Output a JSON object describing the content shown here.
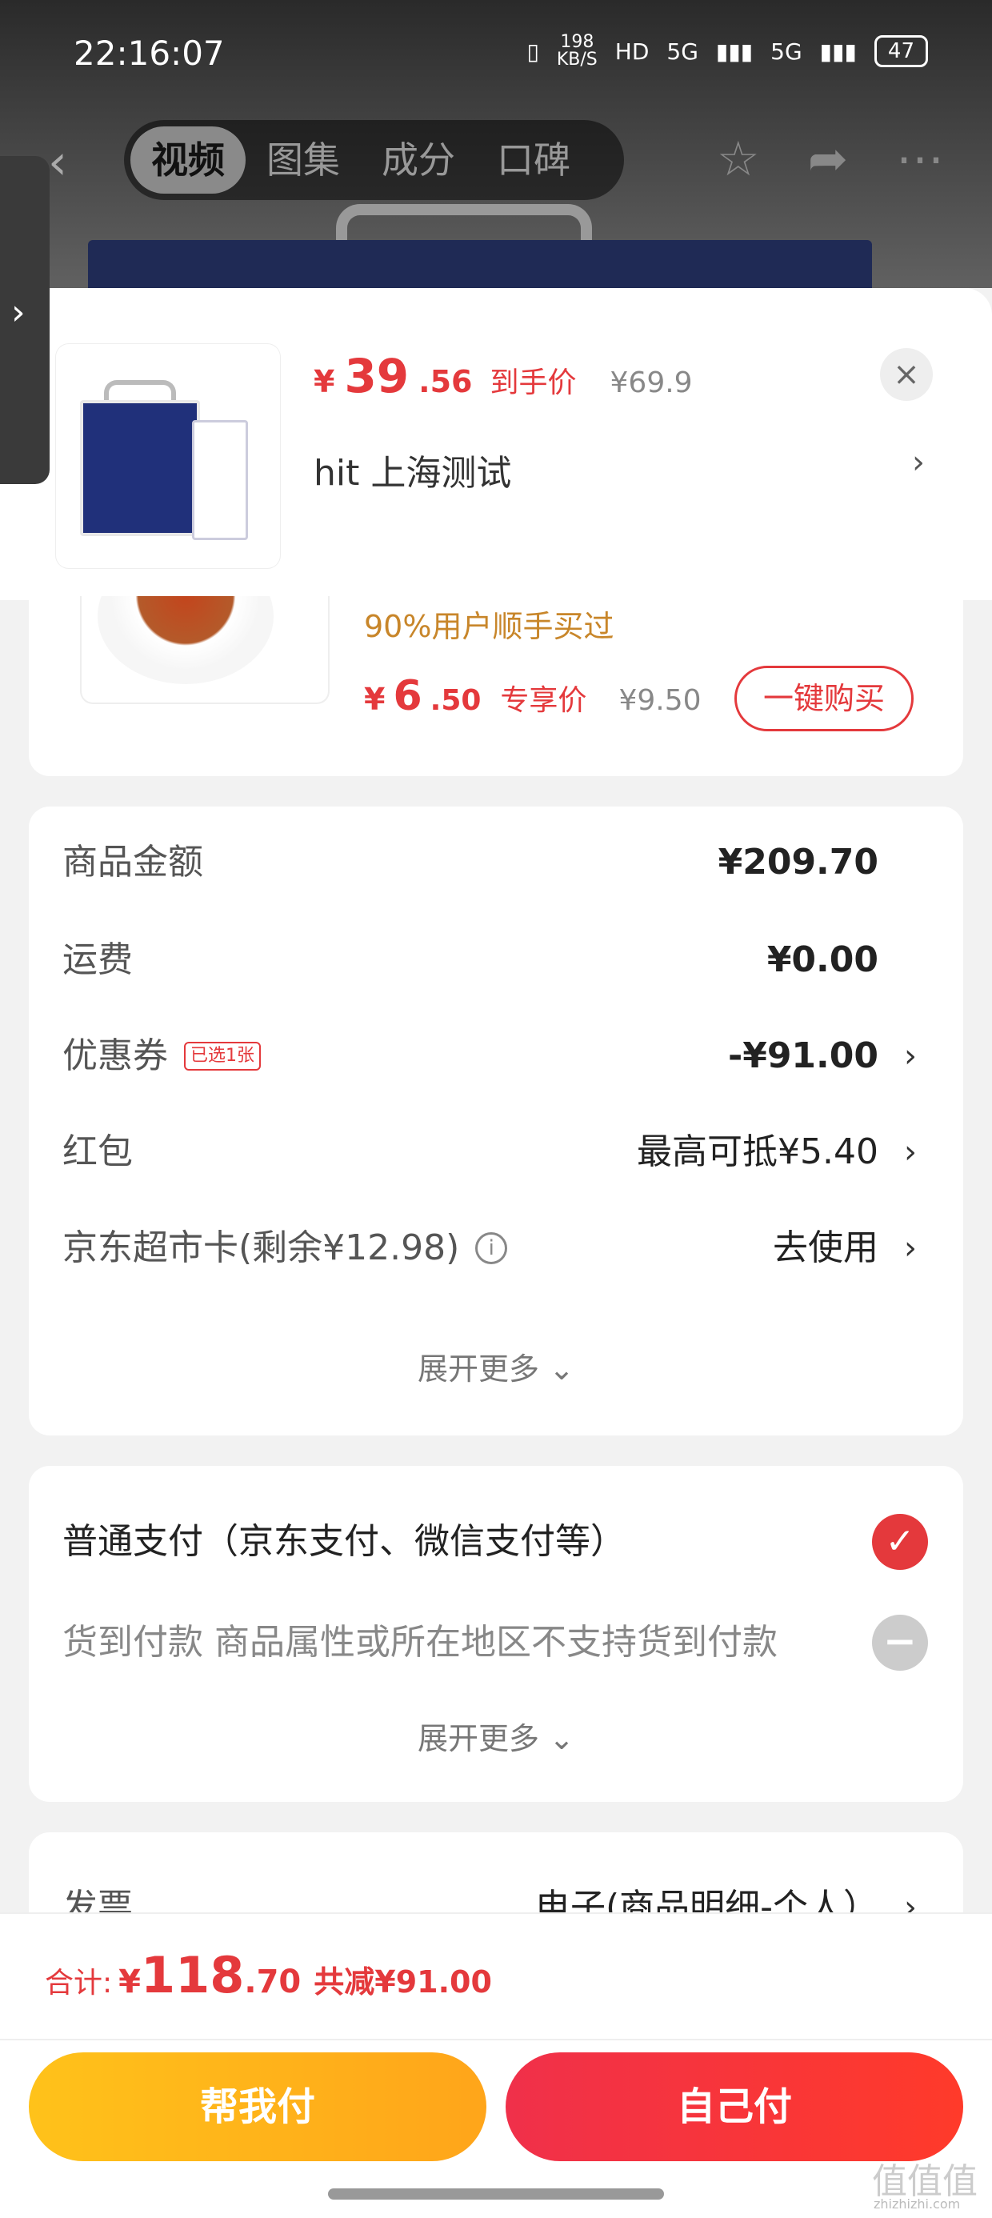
{
  "status_bar": {
    "time": "22:16:07",
    "net_speed": "198",
    "net_unit": "KB/S",
    "hd": "HD",
    "sig1": "5G",
    "sig2": "5G",
    "battery": "47"
  },
  "nav": {
    "tabs": [
      "视频",
      "图集",
      "成分",
      "口碑"
    ]
  },
  "product": {
    "price_symbol": "¥",
    "price_int": "39",
    "price_dec": ".56",
    "price_label": "到手价",
    "orig_price": "¥69.9",
    "close": "×",
    "address": "hit  上海测试",
    "address_arrow": "›"
  },
  "recommend": {
    "buyers": "90%用户顺手买过",
    "price_symbol": "¥",
    "price_int": "6",
    "price_dec": ".50",
    "price_label": "专享价",
    "orig_price": "¥9.50",
    "buy_button": "一键购买"
  },
  "costs": {
    "goods_label": "商品金额",
    "goods_value": "¥209.70",
    "shipping_label": "运费",
    "shipping_value": "¥0.00",
    "coupon_label": "优惠券",
    "coupon_tag": "已选1张",
    "coupon_value": "-¥91.00",
    "redpack_label": "红包",
    "redpack_value": "最高可抵¥5.40",
    "card_label": "京东超市卡(剩余¥12.98)",
    "card_info": "i",
    "card_value": "去使用",
    "arrow": "›",
    "expand": "展开更多 ⌄"
  },
  "payment": {
    "normal_label": "普通支付（京东支付、微信支付等）",
    "cod_label": "货到付款 商品属性或所在地区不支持货到付款",
    "check": "✓",
    "disabled": "−",
    "expand": "展开更多 ⌄"
  },
  "invoice": {
    "label": "发票",
    "value": "电子(商品明细-个人）",
    "arrow": "›"
  },
  "bottom": {
    "total_label": "合计:",
    "total_symbol": "¥",
    "total_int": "118",
    "total_dec": ".70",
    "total_save": "共减¥91.00",
    "help_pay": "帮我付",
    "self_pay": "自己付"
  },
  "watermark": {
    "logo": "值值值",
    "site": "zhizhizhi.com"
  },
  "colors": {
    "accent_red": "#e4393c",
    "help_yellow": "#ffb01a",
    "buyers_orange": "#c8862a"
  }
}
